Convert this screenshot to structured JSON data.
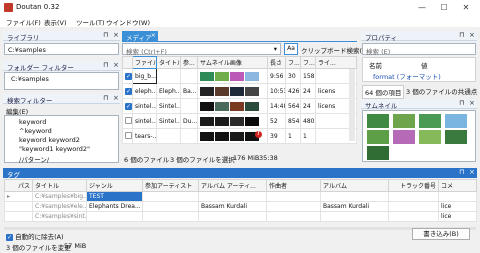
{
  "window": {
    "title": "Doutan 0.32",
    "min": "—",
    "max": "☐",
    "close": "✕"
  },
  "menus": [
    "ファイル(F)",
    "表示(V)",
    "ツール(T)",
    "ウインドウ(W)"
  ],
  "library": {
    "header": "ライブラリ",
    "path": "C:¥samples"
  },
  "folder_filter": {
    "header": "フォルダー フィルター",
    "items": [
      "C:¥samples"
    ]
  },
  "search_filter": {
    "header": "検索フィルター",
    "edit_label": "編集(E)",
    "items": [
      "keyword",
      "^keyword",
      "keyword keyword2",
      "\"keyword1 keyword2\"",
      "/パターン/"
    ]
  },
  "media": {
    "tab": "メディア",
    "search_placeholder": "検索 (Ctrl+F)",
    "search_options": "Aa",
    "clipboard_search": "クリップボード検索(C)",
    "columns": [
      "ファイル...",
      "タイトル",
      "参...",
      "サムネイル画像",
      "長さ",
      "フ...",
      "フ...",
      "ライ..."
    ],
    "rows": [
      {
        "checked": true,
        "file": "big_b...",
        "title": "",
        "artist": "",
        "length": "9:56",
        "fps": "30",
        "size": "158",
        "license": ""
      },
      {
        "checked": true,
        "file": "eleph...",
        "title": "Eleph...",
        "artist": "Ba...",
        "length": "10:53",
        "fps": "426",
        "size": "24",
        "license": "licens"
      },
      {
        "checked": true,
        "file": "sintel...",
        "title": "Sintel...",
        "artist": "",
        "length": "14:48",
        "fps": "564",
        "size": "24",
        "license": "licens"
      },
      {
        "checked": false,
        "file": "sintel...",
        "title": "Sintel...",
        "artist": "Du...",
        "length": "52",
        "fps": "854",
        "size": "480",
        "license": ""
      },
      {
        "checked": false,
        "file": "tears-...",
        "title": "",
        "artist": "",
        "length": "39",
        "fps": "1",
        "size": "1",
        "license": ""
      }
    ],
    "status_count": "6 個のファイル",
    "status_selected": "3 個のファイルを選択",
    "status_size": "176 MiB",
    "status_time": "35:38"
  },
  "properties": {
    "header": "プロパティ",
    "search_placeholder": "検索 (E)",
    "col_name": "名前",
    "col_value": "値",
    "items": [
      {
        "name": "format (フォーマット)",
        "value": ""
      }
    ],
    "tab_items": "64 個の項目",
    "tab_common": "3 個のファイルの共通点"
  },
  "thumbnails": {
    "header": "サムネイル"
  },
  "tags": {
    "header": "タグ",
    "columns": [
      "パス",
      "タイトル",
      "ジャンル",
      "参加アーティスト",
      "アルバム アーティ...",
      "作曲者",
      "アルバム",
      "トラック番号",
      "コメ"
    ],
    "rows": [
      {
        "marker": "▸",
        "path": "C:¥samples¥big...",
        "title": "TEST",
        "genre": "",
        "artist": "",
        "album_artist": "",
        "composer": "",
        "album": "",
        "track": "",
        "comment": ""
      },
      {
        "marker": "",
        "path": "C:¥samples¥ele...",
        "title": "Elephants Drea...",
        "genre": "",
        "artist": "Bassam Kurdali",
        "album_artist": "",
        "composer": "Bassam Kurdali",
        "album": "",
        "track": "",
        "comment": "lice"
      },
      {
        "marker": "",
        "path": "C:¥samples¥sint...",
        "title": "",
        "genre": "",
        "artist": "",
        "album_artist": "",
        "composer": "",
        "album": "",
        "track": "",
        "comment": "lice"
      }
    ],
    "auto_delete_label": "自動的に除去(A)",
    "write_button": "書き込み(B)"
  },
  "statusbar": {
    "changed": "3 個のファイルを変更",
    "size": "57 MiB"
  },
  "colors": {
    "accent": "#3b8fd6",
    "tag_header": "#2a73c9"
  }
}
